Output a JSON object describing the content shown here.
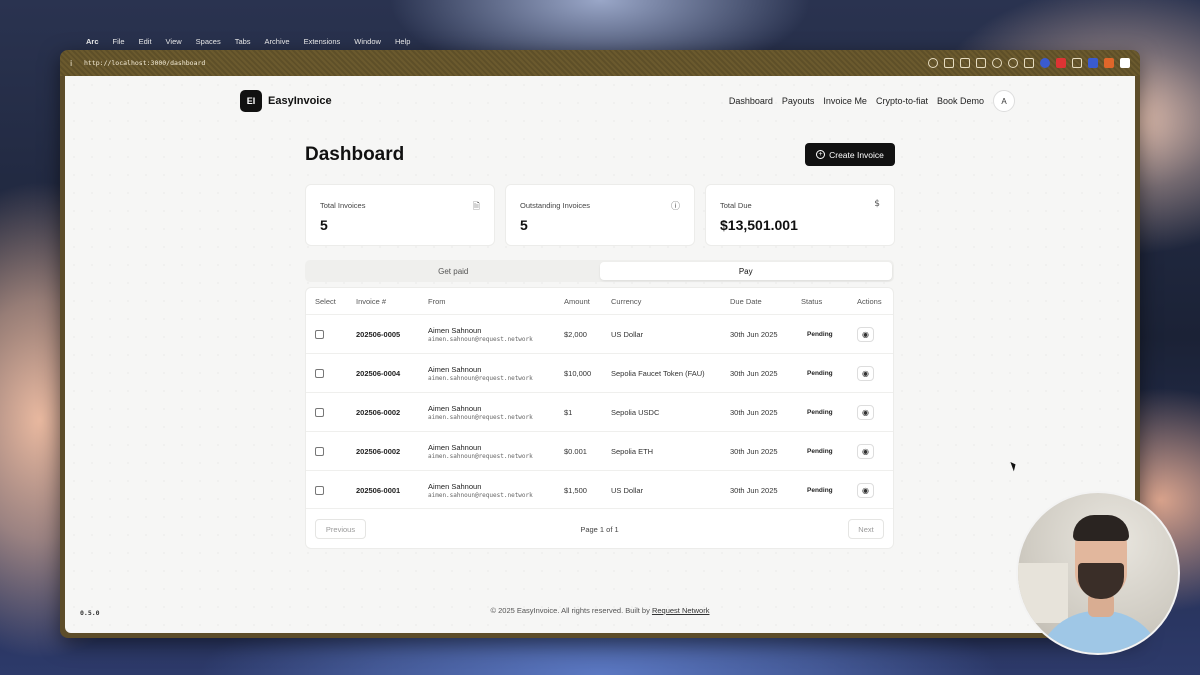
{
  "menubar": {
    "app": "Arc",
    "items": [
      "File",
      "Edit",
      "View",
      "Spaces",
      "Tabs",
      "Archive",
      "Extensions",
      "Window",
      "Help"
    ]
  },
  "browser": {
    "url": "http://localhost:3000/dashboard"
  },
  "header": {
    "logo_text": "EI",
    "brand": "EasyInvoice",
    "nav": [
      "Dashboard",
      "Payouts",
      "Invoice Me",
      "Crypto-to-fiat",
      "Book Demo"
    ],
    "avatar": "A"
  },
  "page": {
    "title": "Dashboard",
    "create_button": "Create Invoice"
  },
  "cards": [
    {
      "label": "Total Invoices",
      "value": "5",
      "icon": "file-icon"
    },
    {
      "label": "Outstanding Invoices",
      "value": "5",
      "icon": "alert-circle-icon"
    },
    {
      "label": "Total Due",
      "value": "$13,501.001",
      "icon": "dollar-icon"
    }
  ],
  "tabs": [
    {
      "label": "Get paid",
      "active": false
    },
    {
      "label": "Pay",
      "active": true
    }
  ],
  "table": {
    "headers": [
      "Select",
      "Invoice #",
      "From",
      "Amount",
      "Currency",
      "Due Date",
      "Status",
      "Actions"
    ],
    "rows": [
      {
        "invoice": "202506-0005",
        "from_name": "Aimen Sahnoun",
        "from_email": "aimen.sahnoun@request.network",
        "amount": "$2,000",
        "currency": "US Dollar",
        "due": "30th Jun 2025",
        "status": "Pending"
      },
      {
        "invoice": "202506-0004",
        "from_name": "Aimen Sahnoun",
        "from_email": "aimen.sahnoun@request.network",
        "amount": "$10,000",
        "currency": "Sepolia Faucet Token (FAU)",
        "due": "30th Jun 2025",
        "status": "Pending"
      },
      {
        "invoice": "202506-0002",
        "from_name": "Aimen Sahnoun",
        "from_email": "aimen.sahnoun@request.network",
        "amount": "$1",
        "currency": "Sepolia USDC",
        "due": "30th Jun 2025",
        "status": "Pending"
      },
      {
        "invoice": "202506-0002",
        "from_name": "Aimen Sahnoun",
        "from_email": "aimen.sahnoun@request.network",
        "amount": "$0.001",
        "currency": "Sepolia ETH",
        "due": "30th Jun 2025",
        "status": "Pending"
      },
      {
        "invoice": "202506-0001",
        "from_name": "Aimen Sahnoun",
        "from_email": "aimen.sahnoun@request.network",
        "amount": "$1,500",
        "currency": "US Dollar",
        "due": "30th Jun 2025",
        "status": "Pending"
      }
    ]
  },
  "pagination": {
    "previous": "Previous",
    "info": "Page 1 of 1",
    "next": "Next"
  },
  "footer": {
    "text": "© 2025 EasyInvoice. All rights reserved. Built by",
    "link": "Request Network",
    "version": "0.5.0"
  }
}
